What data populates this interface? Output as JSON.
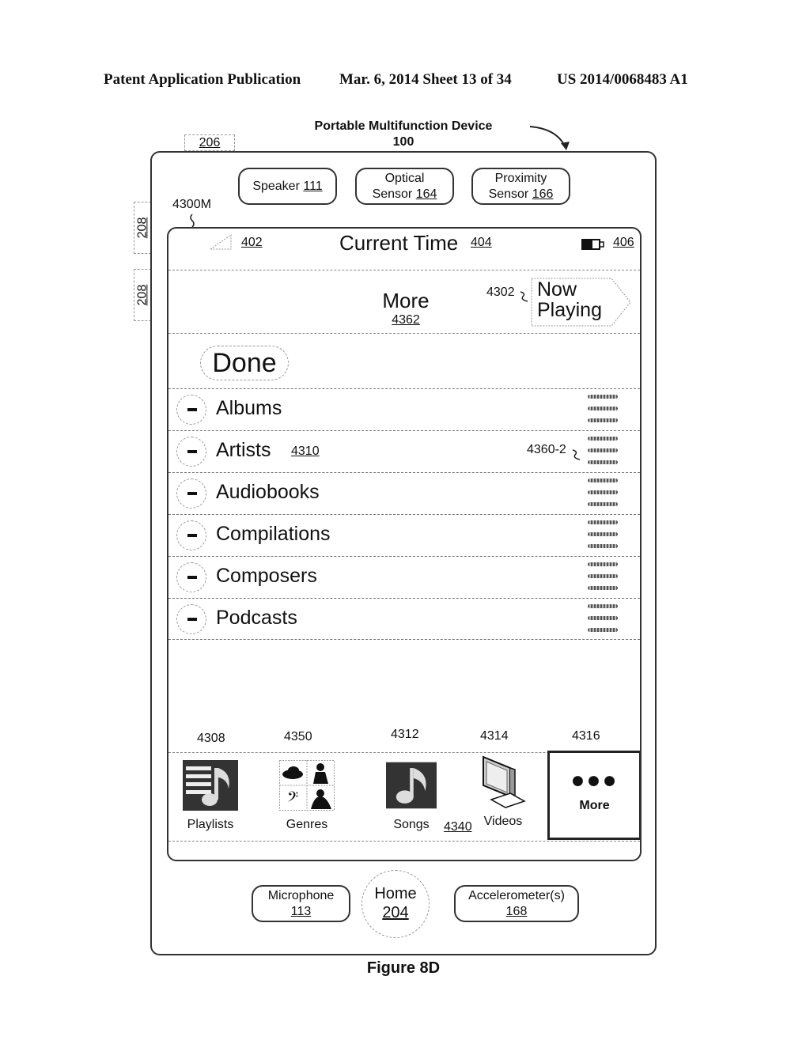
{
  "patent_header": {
    "left": "Patent Application Publication",
    "middle": "Mar. 6, 2014   Sheet 13 of 34",
    "right": "US 2014/0068483 A1"
  },
  "device": {
    "title": "Portable Multifunction Device",
    "ref": "100",
    "ref_206": "206",
    "side_buttons": [
      "208",
      "208"
    ],
    "screen_ref": "4300M"
  },
  "top_sensors": [
    {
      "label": "Speaker",
      "ref": "111"
    },
    {
      "label": "Optical",
      "label2": "Sensor",
      "ref": "164"
    },
    {
      "label": "Proximity",
      "label2": "Sensor",
      "ref": "166"
    }
  ],
  "status_bar": {
    "signal_ref": "402",
    "time_label": "Current Time",
    "time_ref": "404",
    "battery_ref": "406"
  },
  "nav_bar": {
    "title": "More",
    "title_ref": "4362",
    "now_playing_ref": "4302",
    "now_playing_line1": "Now",
    "now_playing_line2": "Playing"
  },
  "done_button": "Done",
  "list": {
    "items": [
      {
        "label": "Albums"
      },
      {
        "label": "Artists",
        "ref": "4310",
        "grip_ref": "4360-2"
      },
      {
        "label": "Audiobooks"
      },
      {
        "label": "Compilations"
      },
      {
        "label": "Composers"
      },
      {
        "label": "Podcasts"
      }
    ]
  },
  "tab_bar": {
    "ref": "4340",
    "tabs": [
      {
        "label": "Playlists",
        "ref": "4308",
        "icon": "playlist-icon"
      },
      {
        "label": "Genres",
        "ref": "4350",
        "icon": "genres-icon"
      },
      {
        "label": "Songs",
        "ref": "4312",
        "icon": "music-note-icon"
      },
      {
        "label": "Videos",
        "ref": "4314",
        "icon": "tv-icon"
      },
      {
        "label": "More",
        "ref": "4316",
        "icon": "ellipsis-icon",
        "selected": true
      }
    ]
  },
  "bottom_hardware": [
    {
      "label": "Microphone",
      "ref": "113"
    },
    {
      "label": "Home",
      "ref": "204"
    },
    {
      "label": "Accelerometer(s)",
      "ref": "168"
    }
  ],
  "figure_label": "Figure 8D"
}
